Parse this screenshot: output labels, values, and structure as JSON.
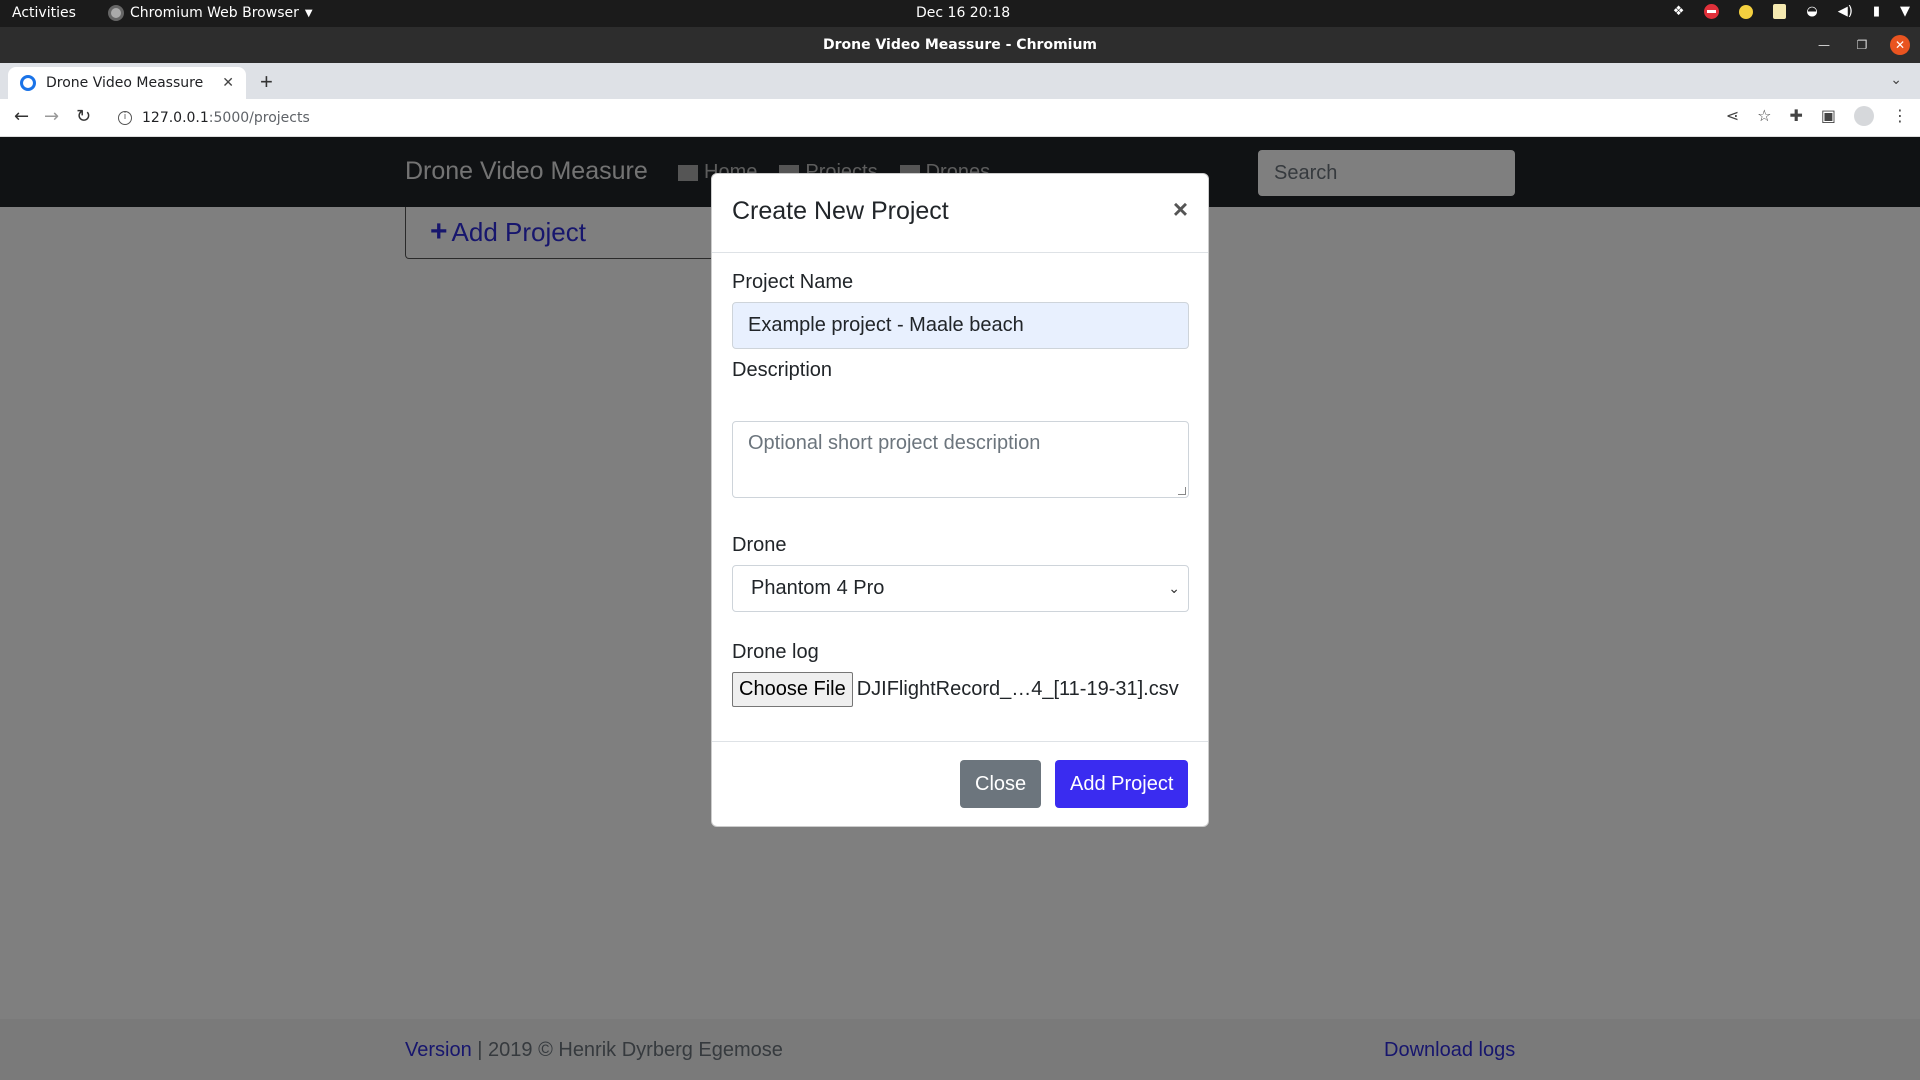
{
  "os": {
    "activities": "Activities",
    "app_menu": "Chromium Web Browser",
    "clock": "Dec 16  20:18"
  },
  "window": {
    "title": "Drone Video Meassure - Chromium"
  },
  "browser": {
    "tab_title": "Drone Video Meassure",
    "url_host": "127.0.0.1",
    "url_path": ":5000/projects"
  },
  "navbar": {
    "brand": "Drone Video Measure",
    "links": [
      {
        "label": "Home",
        "icon": "home-icon"
      },
      {
        "label": "Projects",
        "icon": "folder-icon"
      },
      {
        "label": "Drones",
        "icon": "plane-icon"
      }
    ],
    "search_placeholder": "Search"
  },
  "main": {
    "add_project_label": "Add Project"
  },
  "modal": {
    "title": "Create New Project",
    "close_symbol": "×",
    "project_name_label": "Project Name",
    "project_name_value": "Example project - Maale beach",
    "description_label": "Description",
    "description_placeholder": "Optional short project description",
    "drone_label": "Drone",
    "drone_selected": "Phantom 4 Pro",
    "drone_log_label": "Drone log",
    "choose_file_label": "Choose File",
    "file_name": "DJIFlightRecord_…4_[11-19-31].csv",
    "close_button": "Close",
    "add_button": "Add Project"
  },
  "footer": {
    "version_link": "Version",
    "copyright": " | 2019 © Henrik Dyrberg Egemose",
    "download_logs": "Download logs"
  },
  "colors": {
    "primary": "#3a2cf0",
    "link": "#2f2ddb",
    "navbar_bg": "#212529",
    "secondary": "#6c757d"
  }
}
